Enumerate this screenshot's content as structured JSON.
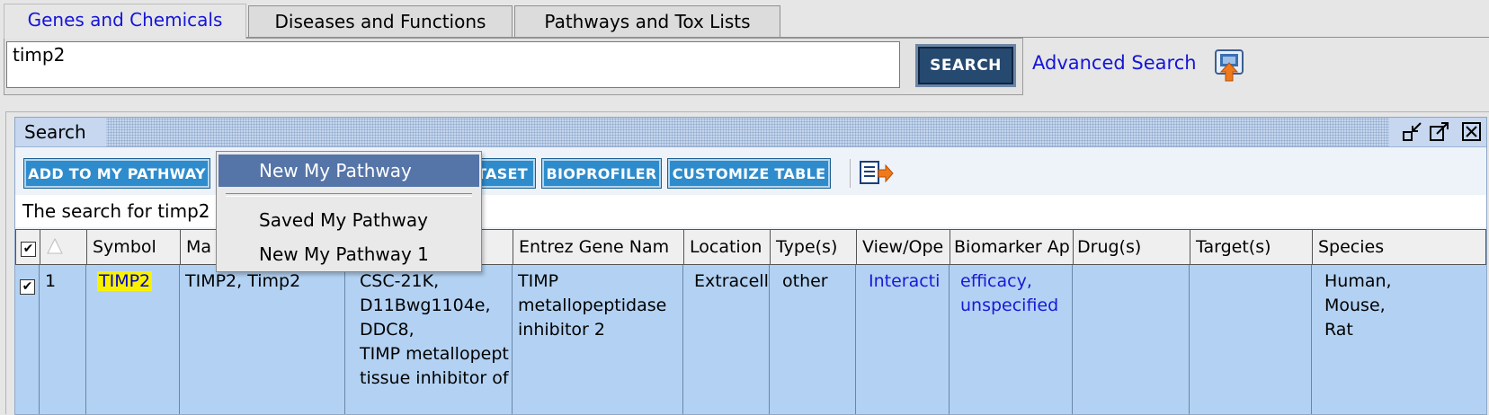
{
  "tabs": [
    {
      "label": "Genes and Chemicals",
      "active": true
    },
    {
      "label": "Diseases and Functions",
      "active": false
    },
    {
      "label": "Pathways and Tox Lists",
      "active": false
    }
  ],
  "search": {
    "value": "timp2",
    "button": "SEARCH",
    "advanced": "Advanced Search"
  },
  "window": {
    "title": "Search"
  },
  "toolbar": {
    "add_to_pathway": "ADD TO MY PATHWAY",
    "dataset_partial": "TASET",
    "bioprofiler": "BIOPROFILER",
    "customize_table": "CUSTOMIZE TABLE"
  },
  "status": {
    "text": "The search for timp2"
  },
  "menu": {
    "items": [
      "New My Pathway",
      "Saved My Pathway",
      "New My Pathway 1"
    ],
    "selected": "New My Pathway"
  },
  "table": {
    "headers": {
      "symbol": "Symbol",
      "matches": "Ma",
      "entrez": "Entrez Gene Nam",
      "location": "Location",
      "types": "Type(s)",
      "view": "View/Ope",
      "biomarker": "Biomarker Ap",
      "drugs": "Drug(s)",
      "targets": "Target(s)",
      "species": "Species"
    },
    "row": {
      "index": "1",
      "symbol": "TIMP2",
      "matches": "TIMP2, Timp2",
      "synonyms": [
        "CSC-21K,",
        "D11Bwg1104e,",
        "DDC8,",
        "TIMP metallopept",
        "tissue inhibitor of"
      ],
      "entrez": [
        "TIMP",
        "metallopeptidase",
        "inhibitor 2"
      ],
      "location": "Extracell",
      "types": "other",
      "view": "Interacti",
      "biomarker": [
        "efficacy,",
        "unspecified"
      ],
      "species": [
        "Human,",
        "Mouse,",
        "Rat"
      ]
    }
  },
  "icons": [
    "export-icon",
    "minimize-icon",
    "maximize-icon",
    "close-icon",
    "checkbox-icon",
    "sort-arrow-icon"
  ],
  "colors": {
    "button_blue": "#2f8ccc",
    "search_button": "#26496f",
    "link": "#1515d8",
    "row_selected": "#b3d2f3",
    "menu_selected": "#5574a8",
    "highlight": "#f8f200"
  }
}
